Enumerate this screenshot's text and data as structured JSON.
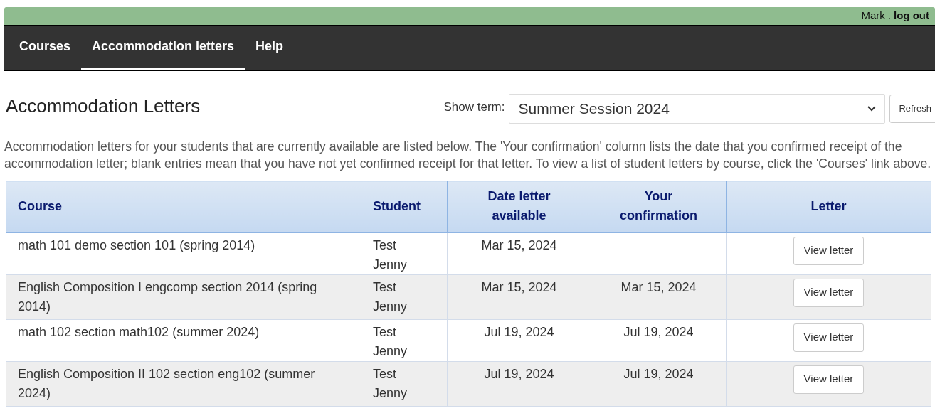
{
  "user_bar": {
    "user": "Mark",
    "separator": ".",
    "logout": "log out"
  },
  "nav": [
    {
      "label": "Courses",
      "selected": false
    },
    {
      "label": "Accommodation letters",
      "selected": true
    },
    {
      "label": "Help",
      "selected": false
    }
  ],
  "page_title": "Accommodation Letters",
  "term": {
    "label": "Show term:",
    "value": "Summer Session 2024",
    "button": "Refresh"
  },
  "intro": "Accommodation letters for your students that are currently available are listed below. The 'Your confirmation' column lists the date that you confirmed receipt of the accommodation letter; blank entries mean that you have not yet confirmed receipt for that letter. To view a list of student letters by course, click the 'Courses' link above.",
  "table": {
    "columns": [
      "Course",
      "Student",
      "Date letter available",
      "Your confirmation",
      "Letter"
    ],
    "rows": [
      {
        "course": "math 101 demo section 101 (spring 2014)",
        "student": "Test Jenny",
        "available": "Mar 15, 2024",
        "action": "View letter"
      },
      {
        "course": "English Composition I engcomp section 2014 (spring 2014)",
        "student": "Test Jenny",
        "available": "Mar 15, 2024",
        "confirmation": "Mar 15, 2024",
        "action": "View letter"
      },
      {
        "course": "math 102 section math102 (summer 2024)",
        "student": "Test Jenny",
        "available": "Jul 19, 2024",
        "confirmation": "Jul 19, 2024",
        "action": "View letter"
      },
      {
        "course": "English Composition II 102 section eng102 (summer 2024)",
        "student": "Test Jenny",
        "available": "Jul 19, 2024",
        "confirmation": "Jul 19, 2024",
        "action": "View letter"
      }
    ]
  }
}
